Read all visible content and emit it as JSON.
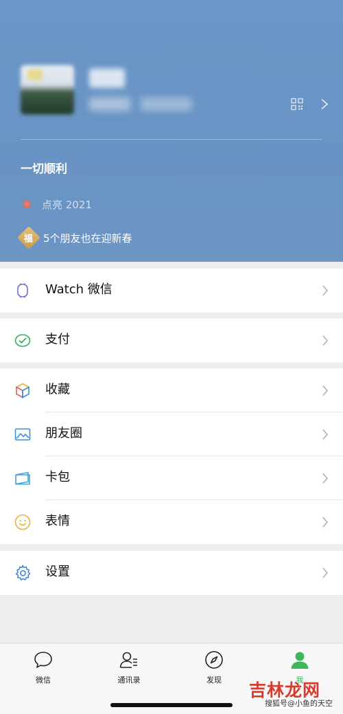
{
  "profile": {
    "status_text": "一切顺利",
    "light_label": "点亮 2021",
    "fu_char": "福",
    "friends_text": "5个朋友也在迎新春"
  },
  "menu": {
    "watch": {
      "label": "Watch 微信",
      "icon": "watch-icon"
    },
    "pay": {
      "label": "支付",
      "icon": "wallet-icon"
    },
    "favorites": {
      "label": "收藏",
      "icon": "cube-icon"
    },
    "moments": {
      "label": "朋友圈",
      "icon": "image-icon"
    },
    "cards": {
      "label": "卡包",
      "icon": "card-icon"
    },
    "stickers": {
      "label": "表情",
      "icon": "smile-icon"
    },
    "settings": {
      "label": "设置",
      "icon": "gear-icon"
    }
  },
  "tabs": [
    {
      "label": "微信",
      "icon": "chat-icon",
      "active": false
    },
    {
      "label": "通讯录",
      "icon": "contacts-icon",
      "active": false
    },
    {
      "label": "发现",
      "icon": "compass-icon",
      "active": false
    },
    {
      "label": "我",
      "icon": "person-icon",
      "active": true
    }
  ],
  "watermark": {
    "main": "吉林龙网",
    "sub": "搜狐号@小鱼的天空"
  },
  "colors": {
    "header_bg": "#6993c4",
    "accent_green": "#3fb55e",
    "page_bg": "#ededed"
  }
}
